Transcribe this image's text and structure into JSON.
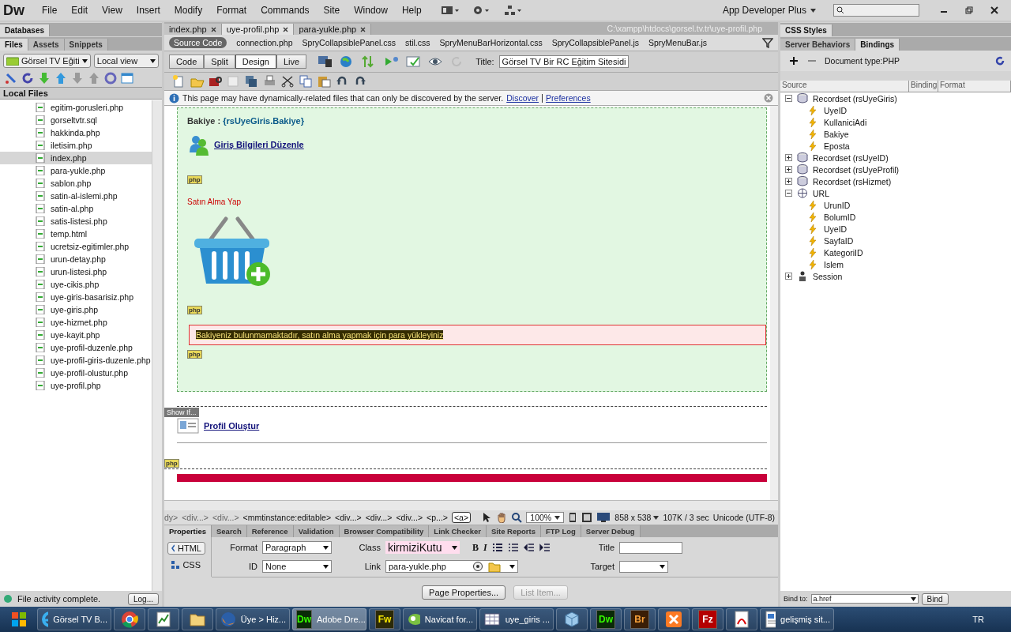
{
  "app": {
    "logo": "Dw",
    "menus": [
      "File",
      "Edit",
      "View",
      "Insert",
      "Modify",
      "Format",
      "Commands",
      "Site",
      "Window",
      "Help"
    ],
    "workspace": "App Developer Plus"
  },
  "left_panel": {
    "databases_tab": "Databases",
    "tabs": [
      {
        "label": "Files",
        "selected": true
      },
      {
        "label": "Assets",
        "selected": false
      },
      {
        "label": "Snippets",
        "selected": false
      }
    ],
    "site": "Görsel TV Eğiti",
    "view": "Local view",
    "header": "Local Files",
    "files": [
      {
        "name": "egitim-gorusleri.php",
        "selected": false
      },
      {
        "name": "gorseltvtr.sql",
        "selected": false
      },
      {
        "name": "hakkinda.php",
        "selected": false
      },
      {
        "name": "iletisim.php",
        "selected": false
      },
      {
        "name": "index.php",
        "selected": true
      },
      {
        "name": "para-yukle.php",
        "selected": false
      },
      {
        "name": "sablon.php",
        "selected": false
      },
      {
        "name": "satin-al-islemi.php",
        "selected": false
      },
      {
        "name": "satin-al.php",
        "selected": false
      },
      {
        "name": "satis-listesi.php",
        "selected": false
      },
      {
        "name": "temp.html",
        "selected": false
      },
      {
        "name": "ucretsiz-egitimler.php",
        "selected": false
      },
      {
        "name": "urun-detay.php",
        "selected": false
      },
      {
        "name": "urun-listesi.php",
        "selected": false
      },
      {
        "name": "uye-cikis.php",
        "selected": false
      },
      {
        "name": "uye-giris-basarisiz.php",
        "selected": false
      },
      {
        "name": "uye-giris.php",
        "selected": false
      },
      {
        "name": "uye-hizmet.php",
        "selected": false
      },
      {
        "name": "uye-kayit.php",
        "selected": false
      },
      {
        "name": "uye-profil-duzenle.php",
        "selected": false
      },
      {
        "name": "uye-profil-giris-duzenle.php",
        "selected": false
      },
      {
        "name": "uye-profil-olustur.php",
        "selected": false
      },
      {
        "name": "uye-profil.php",
        "selected": false
      }
    ],
    "status": "File activity complete.",
    "log_button": "Log..."
  },
  "document": {
    "tabs": [
      {
        "label": "index.php",
        "selected": false
      },
      {
        "label": "uye-profil.php",
        "selected": true
      },
      {
        "label": "para-yukle.php",
        "selected": false
      }
    ],
    "path": "C:\\xampp\\htdocs\\gorsel.tv.tr\\uye-profil.php",
    "related_files": [
      {
        "label": "Source Code",
        "selected": true
      },
      {
        "label": "connection.php",
        "selected": false
      },
      {
        "label": "SpryCollapsiblePanel.css",
        "selected": false
      },
      {
        "label": "stil.css",
        "selected": false
      },
      {
        "label": "SpryMenuBarHorizontal.css",
        "selected": false
      },
      {
        "label": "SpryCollapsiblePanel.js",
        "selected": false
      },
      {
        "label": "SpryMenuBar.js",
        "selected": false
      }
    ],
    "views": [
      {
        "label": "Code",
        "selected": false
      },
      {
        "label": "Split",
        "selected": false
      },
      {
        "label": "Design",
        "selected": true
      },
      {
        "label": "Live",
        "selected": false
      }
    ],
    "title_label": "Title:",
    "title_value": "Görsel TV Bir RC Eğitim Sitesidi",
    "info": {
      "text": "This page may have dynamically-related files that can only be discovered by the server.",
      "links": [
        "Discover",
        "Preferences"
      ]
    },
    "content": [
      {
        "kind": "binding",
        "label": "Bakiye :",
        "value": "{rsUyeGiris.Bakiye}"
      },
      {
        "kind": "user-link",
        "label": "Giriş Bilgileri Düzenle"
      },
      {
        "kind": "php",
        "label": "php"
      },
      {
        "kind": "heading",
        "label": "Satın Alma Yap"
      },
      {
        "kind": "basket"
      },
      {
        "kind": "php",
        "label": "php"
      },
      {
        "kind": "alert",
        "label": "Bakiyeniz bulunmamaktadır, satın alma yapmak için para yükleyiniz"
      },
      {
        "kind": "php",
        "label": "php"
      }
    ],
    "show_if": "Show If...",
    "profile_link": "Profil Oluştur",
    "bottom_php": "php",
    "tag_selector": [
      {
        "label": "dy>",
        "selected": false
      },
      {
        "label": "<div...>",
        "selected": false
      },
      {
        "label": "<div...>",
        "selected": false
      },
      {
        "label": "<mmtinstance:editable>",
        "selected": false
      },
      {
        "label": "<div...>",
        "selected": false
      },
      {
        "label": "<div...>",
        "selected": false
      },
      {
        "label": "<div...>",
        "selected": false
      },
      {
        "label": "<p...>",
        "selected": false
      },
      {
        "label": "<a>",
        "selected": true
      }
    ],
    "zoom": "100%",
    "size": "858 x 538",
    "speed": "107K / 3 sec",
    "encoding": "Unicode (UTF-8)"
  },
  "properties": {
    "tabs": [
      {
        "label": "Properties",
        "selected": true
      },
      {
        "label": "Search",
        "selected": false
      },
      {
        "label": "Reference",
        "selected": false
      },
      {
        "label": "Validation",
        "selected": false
      },
      {
        "label": "Browser Compatibility",
        "selected": false
      },
      {
        "label": "Link Checker",
        "selected": false
      },
      {
        "label": "Site Reports",
        "selected": false
      },
      {
        "label": "FTP Log",
        "selected": false
      },
      {
        "label": "Server Debug",
        "selected": false
      }
    ],
    "html_button": "HTML",
    "css_button": "CSS",
    "format_label": "Format",
    "format_value": "Paragraph",
    "id_label": "ID",
    "id_value": "None",
    "class_label": "Class",
    "class_value": "kirmiziKutu",
    "bold_button": "B",
    "italic_button": "I",
    "link_label": "Link",
    "link_value": "para-yukle.php",
    "title_label": "Title",
    "target_label": "Target",
    "page_properties": "Page Properties...",
    "list_item": "List Item..."
  },
  "right_panel": {
    "css_styles": "CSS Styles",
    "tabs": [
      {
        "label": "Server Behaviors",
        "selected": false
      },
      {
        "label": "Bindings",
        "selected": true
      }
    ],
    "doc_type": "Document type:PHP",
    "columns": [
      "Source",
      "Binding",
      "Format"
    ],
    "tree": [
      {
        "label": "Recordset (rsUyeGiris)",
        "kind": "recordset",
        "expanded": true,
        "children": [
          {
            "label": "UyeID"
          },
          {
            "label": "KullaniciAdi"
          },
          {
            "label": "Bakiye"
          },
          {
            "label": "Eposta"
          }
        ]
      },
      {
        "label": "Recordset (rsUyeID)",
        "kind": "recordset",
        "expanded": false
      },
      {
        "label": "Recordset (rsUyeProfil)",
        "kind": "recordset",
        "expanded": false
      },
      {
        "label": "Recordset (rsHizmet)",
        "kind": "recordset",
        "expanded": false
      },
      {
        "label": "URL",
        "kind": "url",
        "expanded": true,
        "children": [
          {
            "label": "UrunID"
          },
          {
            "label": "BolumID"
          },
          {
            "label": "UyeID"
          },
          {
            "label": "SayfaID"
          },
          {
            "label": "KategoriID"
          },
          {
            "label": "Islem"
          }
        ]
      },
      {
        "label": "Session",
        "kind": "session",
        "expanded": false
      }
    ],
    "bind_to_label": "Bind to:",
    "bind_to_value": "a.href",
    "bind_button": "Bind"
  },
  "taskbar": {
    "items": [
      {
        "kind": "ie",
        "label": "Görsel TV B...",
        "active": false
      },
      {
        "kind": "chrome",
        "active": false
      },
      {
        "kind": "chart",
        "active": false
      },
      {
        "kind": "folder",
        "active": false
      },
      {
        "kind": "firefox",
        "label": "Üye > Hiz...",
        "active": false
      },
      {
        "kind": "letter",
        "glyph": "Dw",
        "label": "Adobe Dre...",
        "active": true
      },
      {
        "kind": "letter",
        "glyph": "Fw",
        "active": false
      },
      {
        "kind": "navicat",
        "label": "Navicat for...",
        "active": false
      },
      {
        "kind": "table",
        "label": "uye_giris ...",
        "active": false
      },
      {
        "kind": "cube",
        "active": false
      },
      {
        "kind": "letter",
        "glyph": "Dw",
        "active": false
      },
      {
        "kind": "letter",
        "glyph": "Br",
        "active": false
      },
      {
        "kind": "xampp",
        "active": false
      },
      {
        "kind": "letter",
        "glyph": "Fz",
        "active": false
      },
      {
        "kind": "pdf",
        "active": false
      },
      {
        "kind": "doc",
        "label": "gelişmiş sit...",
        "active": false
      }
    ],
    "language": "TR"
  }
}
